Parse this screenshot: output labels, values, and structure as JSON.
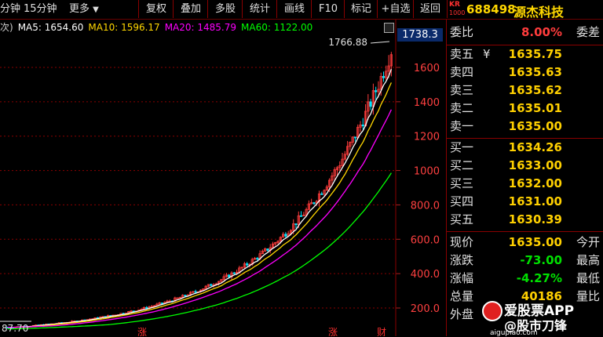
{
  "toolbar": {
    "left_cut": "分钟",
    "period": "15分钟",
    "more": "更多",
    "buttons": [
      "复权",
      "叠加",
      "多股",
      "统计",
      "画线",
      "F10",
      "标记",
      "+自选",
      "返回"
    ]
  },
  "stock": {
    "exchange_tag": "KR",
    "exchange_sub": "1000",
    "code": "688498",
    "name": "源杰科技"
  },
  "ma": {
    "prefix": "次)",
    "ma5": "MA5: 1654.60",
    "ma10": "MA10: 1596.17",
    "ma20": "MA20: 1485.79",
    "ma60": "MA60: 1122.00"
  },
  "chart": {
    "current_price_label": "1738.3",
    "high_label": "1766.88",
    "low_label": "87.70",
    "axis_ticks": [
      "1600",
      "1400",
      "1200",
      "1000",
      "800.0",
      "600.0",
      "400.0",
      "200.0"
    ],
    "bottom_tags": [
      "涨",
      "涨",
      "财"
    ],
    "colors": {
      "up": "#ff3c3c",
      "down": "#00e5ff",
      "ma5": "#ffffff",
      "ma10": "#ffd700",
      "ma20": "#ff00ff",
      "ma60": "#00ff00"
    }
  },
  "quote": {
    "webi": {
      "label": "委比",
      "value": "8.00%",
      "label2": "委差"
    },
    "asks": [
      {
        "label": "卖五",
        "mark": "¥",
        "price": "1635.75"
      },
      {
        "label": "卖四",
        "price": "1635.63"
      },
      {
        "label": "卖三",
        "price": "1635.62"
      },
      {
        "label": "卖二",
        "price": "1635.01"
      },
      {
        "label": "卖一",
        "price": "1635.00"
      }
    ],
    "bids": [
      {
        "label": "买一",
        "price": "1634.26"
      },
      {
        "label": "买二",
        "price": "1633.00"
      },
      {
        "label": "买三",
        "price": "1632.00"
      },
      {
        "label": "买四",
        "price": "1631.00"
      },
      {
        "label": "买五",
        "price": "1630.39"
      }
    ],
    "stats": [
      {
        "label": "现价",
        "value": "1635.00",
        "label2": "今开",
        "color": "#ffd000"
      },
      {
        "label": "涨跌",
        "value": "-73.00",
        "label2": "最高",
        "color": "#00e000"
      },
      {
        "label": "涨幅",
        "value": "-4.27%",
        "label2": "最低",
        "color": "#00e000"
      },
      {
        "label": "总量",
        "value": "40186",
        "label2": "量比",
        "color": "#ffd000"
      },
      {
        "label": "外盘",
        "value": "",
        "label2": "",
        "color": "#ffd000"
      }
    ]
  },
  "watermark": {
    "line1": "爱股票APP",
    "line2": "@股市刀锋",
    "line3": "aigupiao.com"
  }
}
